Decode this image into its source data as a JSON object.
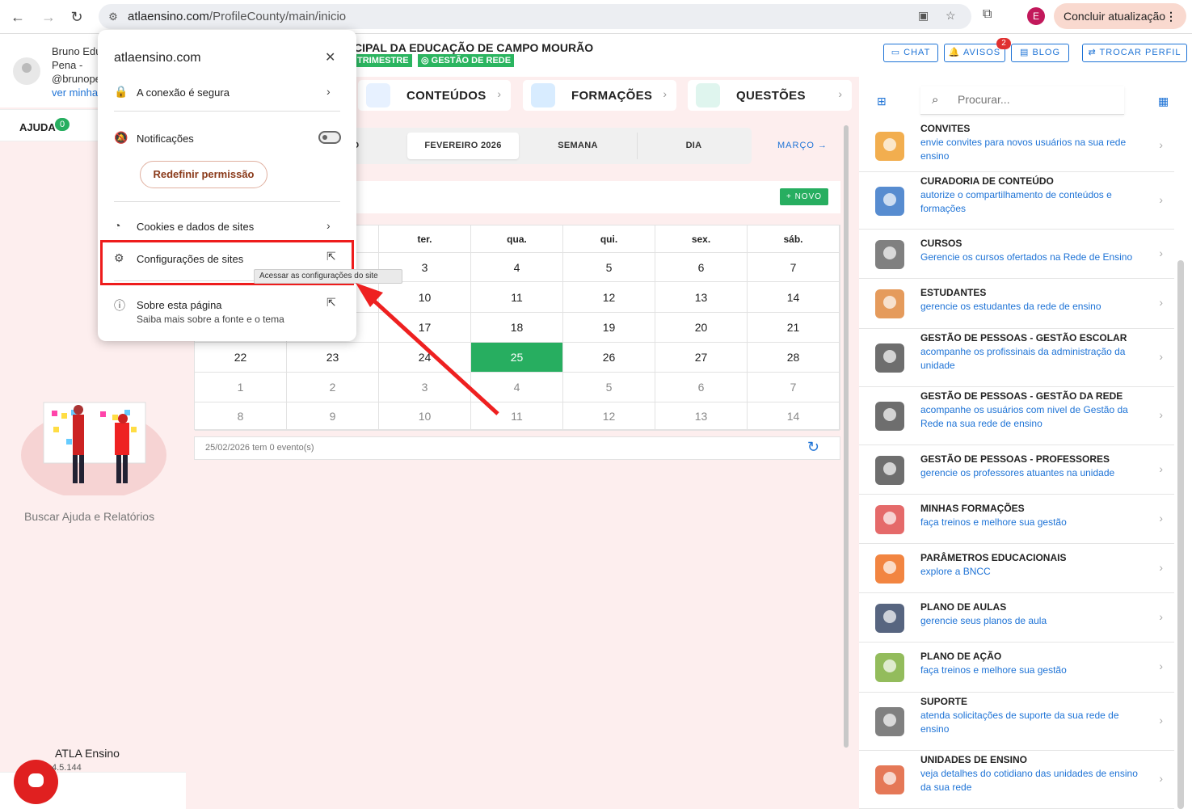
{
  "browser": {
    "url_host": "atlaensino.com",
    "url_path": "/ProfileCounty/main/inicio",
    "profile_initial": "E",
    "update_label": "Concluir atualização"
  },
  "user": {
    "name": "Bruno Edu\nPena -\n@brunope",
    "link": "ver minha"
  },
  "help": {
    "label": "AJUDA",
    "badge": "0",
    "caption": "Buscar Ajuda e Relatórios"
  },
  "app": {
    "name": "ATLA Ensino",
    "version": "4.5.144"
  },
  "header": {
    "title": "CIPAL DA EDUCAÇÃO DE CAMPO MOURÃO",
    "tag_period": "TRIMESTRE",
    "tag_role": "GESTÃO DE REDE",
    "chat": "CHAT",
    "avisos": "AVISOS",
    "avisos_badge": "2",
    "blog": "BLOG",
    "trocar": "TROCAR PERFIL"
  },
  "tiles": [
    "CONTEÚDOS",
    "FORMAÇÕES",
    "QUESTÕES"
  ],
  "calendar": {
    "seg_left": "O",
    "month": "FEVEREIRO 2026",
    "week": "SEMANA",
    "day": "DIA",
    "next": "MARÇO",
    "novo": "NOVO",
    "headers": [
      "",
      "",
      "ter.",
      "qua.",
      "qui.",
      "sex.",
      "sáb."
    ],
    "rows": [
      [
        "",
        "",
        "3",
        "4",
        "5",
        "6",
        "7"
      ],
      [
        "",
        "",
        "10",
        "11",
        "12",
        "13",
        "14"
      ],
      [
        "",
        "",
        "17",
        "18",
        "19",
        "20",
        "21"
      ],
      [
        "22",
        "23",
        "24",
        "25",
        "26",
        "27",
        "28"
      ],
      [
        "1",
        "2",
        "3",
        "4",
        "5",
        "6",
        "7"
      ],
      [
        "8",
        "9",
        "10",
        "11",
        "12",
        "13",
        "14"
      ]
    ],
    "today": "25",
    "events": "25/02/2026 tem 0 evento(s)"
  },
  "search": {
    "placeholder": "Procurar..."
  },
  "menu": [
    {
      "title": "CONVITES",
      "desc": "envie convites para novos usuários na sua rede ensino",
      "color": "#f0a030"
    },
    {
      "title": "CURADORIA DE CONTEÚDO",
      "desc": "autorize o compartilhamento de conteúdos e formações",
      "color": "#3a78c8"
    },
    {
      "title": "CURSOS",
      "desc": "Gerencie os cursos ofertados na Rede de Ensino",
      "color": "#6a6a6a"
    },
    {
      "title": "ESTUDANTES",
      "desc": "gerencie os estudantes da rede de ensino",
      "color": "#e08a40"
    },
    {
      "title": "GESTÃO DE PESSOAS - GESTÃO ESCOLAR",
      "desc": "acompanhe os profissinais da administração da unidade",
      "color": "#555555"
    },
    {
      "title": "GESTÃO DE PESSOAS - GESTÃO DA REDE",
      "desc": "acompanhe os usuários com nivel de Gestão da Rede na sua rede de ensino",
      "color": "#555555"
    },
    {
      "title": "GESTÃO DE PESSOAS - PROFESSORES",
      "desc": "gerencie os professores atuantes na unidade",
      "color": "#555555"
    },
    {
      "title": "MINHAS FORMAÇÕES",
      "desc": "faça treinos e melhore sua gestão",
      "color": "#e05050"
    },
    {
      "title": "PARÂMETROS EDUCACIONAIS",
      "desc": "explore a BNCC",
      "color": "#f07020"
    },
    {
      "title": "PLANO DE AULAS",
      "desc": "gerencie seus planos de aula",
      "color": "#3a4a6a"
    },
    {
      "title": "PLANO DE AÇÃO",
      "desc": "faça treinos e melhore sua gestão",
      "color": "#80b040"
    },
    {
      "title": "SUPORTE",
      "desc": "atenda solicitações de suporte da sua rede de ensino",
      "color": "#6a6a6a"
    },
    {
      "title": "UNIDADES DE ENSINO",
      "desc": "veja detalhes do cotidiano das unidades de ensino da sua rede",
      "color": "#e0603a"
    }
  ],
  "popup": {
    "host": "atlaensino.com",
    "secure": "A conexão é segura",
    "notifications": "Notificações",
    "reset": "Redefinir permissão",
    "cookies": "Cookies e dados de sites",
    "site_settings": "Configurações de sites",
    "tooltip": "Acessar as configurações do site",
    "about": "Sobre esta página",
    "about_sub": "Saiba mais sobre a fonte e o tema"
  }
}
